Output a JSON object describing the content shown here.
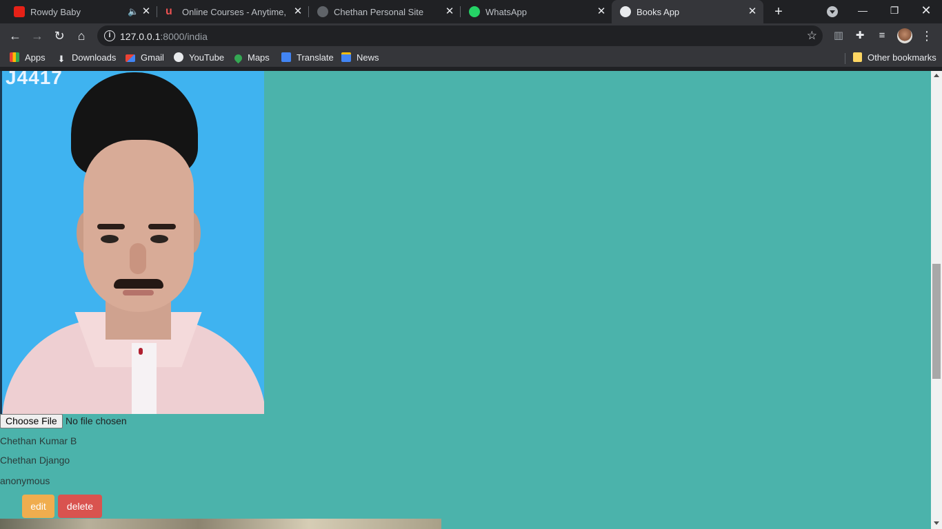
{
  "tabs": [
    {
      "title": "Rowdy Baby",
      "icon": "youtube-icon",
      "color": "#e62117",
      "audio": true
    },
    {
      "title": "Online Courses - Anytime, Anywhere | Udemy",
      "icon": "udemy-icon",
      "color": "#ec5252"
    },
    {
      "title": "Chethan Personal Site",
      "icon": "globe-icon",
      "color": "#9aa0a6"
    },
    {
      "title": "WhatsApp",
      "icon": "whatsapp-icon",
      "color": "#25d366"
    },
    {
      "title": "Books App",
      "icon": "globe-icon",
      "color": "#e8eaed",
      "active": true
    }
  ],
  "address": {
    "host": "127.0.0.1",
    "path": ":8000/india"
  },
  "bookmarks": [
    {
      "label": "Apps",
      "icon": "apps-grid-icon"
    },
    {
      "label": "Downloads",
      "icon": "download-icon"
    },
    {
      "label": "Gmail",
      "icon": "gmail-icon"
    },
    {
      "label": "YouTube",
      "icon": "globe-icon"
    },
    {
      "label": "Maps",
      "icon": "maps-pin-icon"
    },
    {
      "label": "Translate",
      "icon": "translate-icon"
    },
    {
      "label": "News",
      "icon": "news-icon"
    }
  ],
  "other_bookmarks": "Other bookmarks",
  "page": {
    "photo_stamp": "J4417",
    "file_input": {
      "button_label": "Choose File",
      "status": "No file chosen"
    },
    "author": "Chethan Kumar B",
    "book_title": "Chethan Django",
    "uploader": "anonymous",
    "edit_label": "edit",
    "delete_label": "delete"
  },
  "colors": {
    "page_background": "#4bb3ab",
    "edit_button": "#f0ad4e",
    "delete_button": "#d9534f"
  }
}
